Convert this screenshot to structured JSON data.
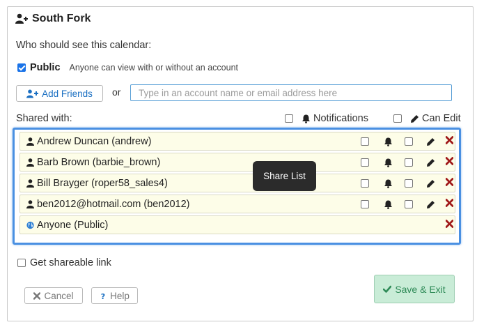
{
  "title": "South Fork",
  "who_label": "Who should see this calendar:",
  "public": {
    "label": "Public",
    "description": "Anyone can view with or without an account",
    "checked": true
  },
  "add_friends_label": "Add Friends",
  "or_label": "or",
  "account_input": {
    "placeholder": "Type in an account name or email address here",
    "value": ""
  },
  "shared_with_label": "Shared with:",
  "header": {
    "notifications_label": "Notifications",
    "can_edit_label": "Can Edit"
  },
  "share_list": [
    {
      "name": "Andrew Duncan (andrew)",
      "type": "user",
      "notifications": false,
      "can_edit": false
    },
    {
      "name": "Barb Brown (barbie_brown)",
      "type": "user",
      "notifications": false,
      "can_edit": false
    },
    {
      "name": "Bill Brayger (roper58_sales4)",
      "type": "user",
      "notifications": false,
      "can_edit": false
    },
    {
      "name": "ben2012@hotmail.com (ben2012)",
      "type": "user",
      "notifications": false,
      "can_edit": false
    },
    {
      "name": "Anyone (Public)",
      "type": "public"
    }
  ],
  "tooltip": "Share List",
  "shareable_link_label": "Get shareable link",
  "cancel_label": "Cancel",
  "help_label": "Help",
  "save_label": "Save & Exit",
  "colors": {
    "accent": "#1a6fc2",
    "highlight": "#4a90e2",
    "row_bg": "#fdfde8",
    "delete": "#a01818",
    "save_bg": "#c9ecd7",
    "save_text": "#2e8a57"
  }
}
